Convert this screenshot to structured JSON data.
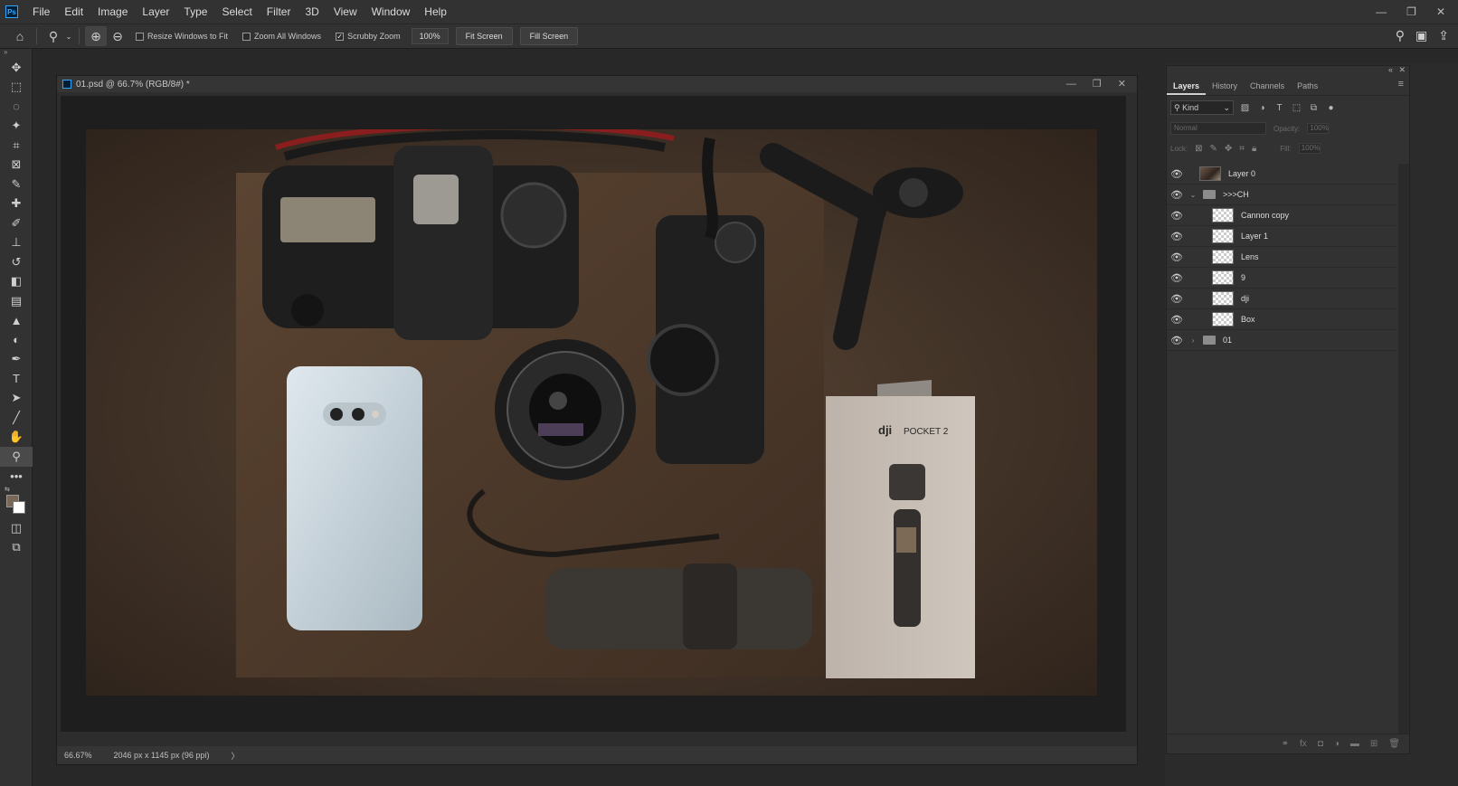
{
  "app": {
    "logo": "Ps"
  },
  "menu": [
    "File",
    "Edit",
    "Image",
    "Layer",
    "Type",
    "Select",
    "Filter",
    "3D",
    "View",
    "Window",
    "Help"
  ],
  "window_controls": {
    "minimize": "—",
    "restore": "❐",
    "close": "✕"
  },
  "options": {
    "resize_windows_label": "Resize Windows to Fit",
    "zoom_all_label": "Zoom All Windows",
    "scrubby_zoom_label": "Scrubby Zoom",
    "scrubby_checked": "✓",
    "zoom_value": "100%",
    "fit_screen": "Fit Screen",
    "fill_screen": "Fill Screen"
  },
  "document": {
    "title": "01.psd @ 66.7% (RGB/8#) *",
    "status_zoom": "66.67%",
    "status_info": "2046 px x 1145 px (96 ppi)",
    "status_arrow": "〉"
  },
  "photo_label": {
    "brand": "dji",
    "product": "POCKET 2"
  },
  "panel": {
    "tabs": [
      "Layers",
      "History",
      "Channels",
      "Paths"
    ],
    "kind_label": "Kind",
    "blend_mode": "Normal",
    "opacity_label": "Opacity:",
    "opacity_value": "100%",
    "lock_label": "Lock:",
    "fill_label": "Fill:",
    "fill_value": "100%",
    "layers": [
      {
        "name": "Layer 0",
        "type": "photo"
      },
      {
        "name": ">>>CH",
        "type": "group-open"
      },
      {
        "name": "Cannon copy",
        "type": "layer"
      },
      {
        "name": "Layer 1",
        "type": "layer"
      },
      {
        "name": "Lens",
        "type": "layer"
      },
      {
        "name": "9",
        "type": "layer"
      },
      {
        "name": "dji",
        "type": "layer"
      },
      {
        "name": "Box",
        "type": "layer"
      },
      {
        "name": "01",
        "type": "group-closed"
      }
    ]
  },
  "colors": {
    "accent": "#31a8ff",
    "ui_bg": "#323232",
    "foreground_swatch": "#7a6755",
    "background_swatch": "#ffffff"
  }
}
